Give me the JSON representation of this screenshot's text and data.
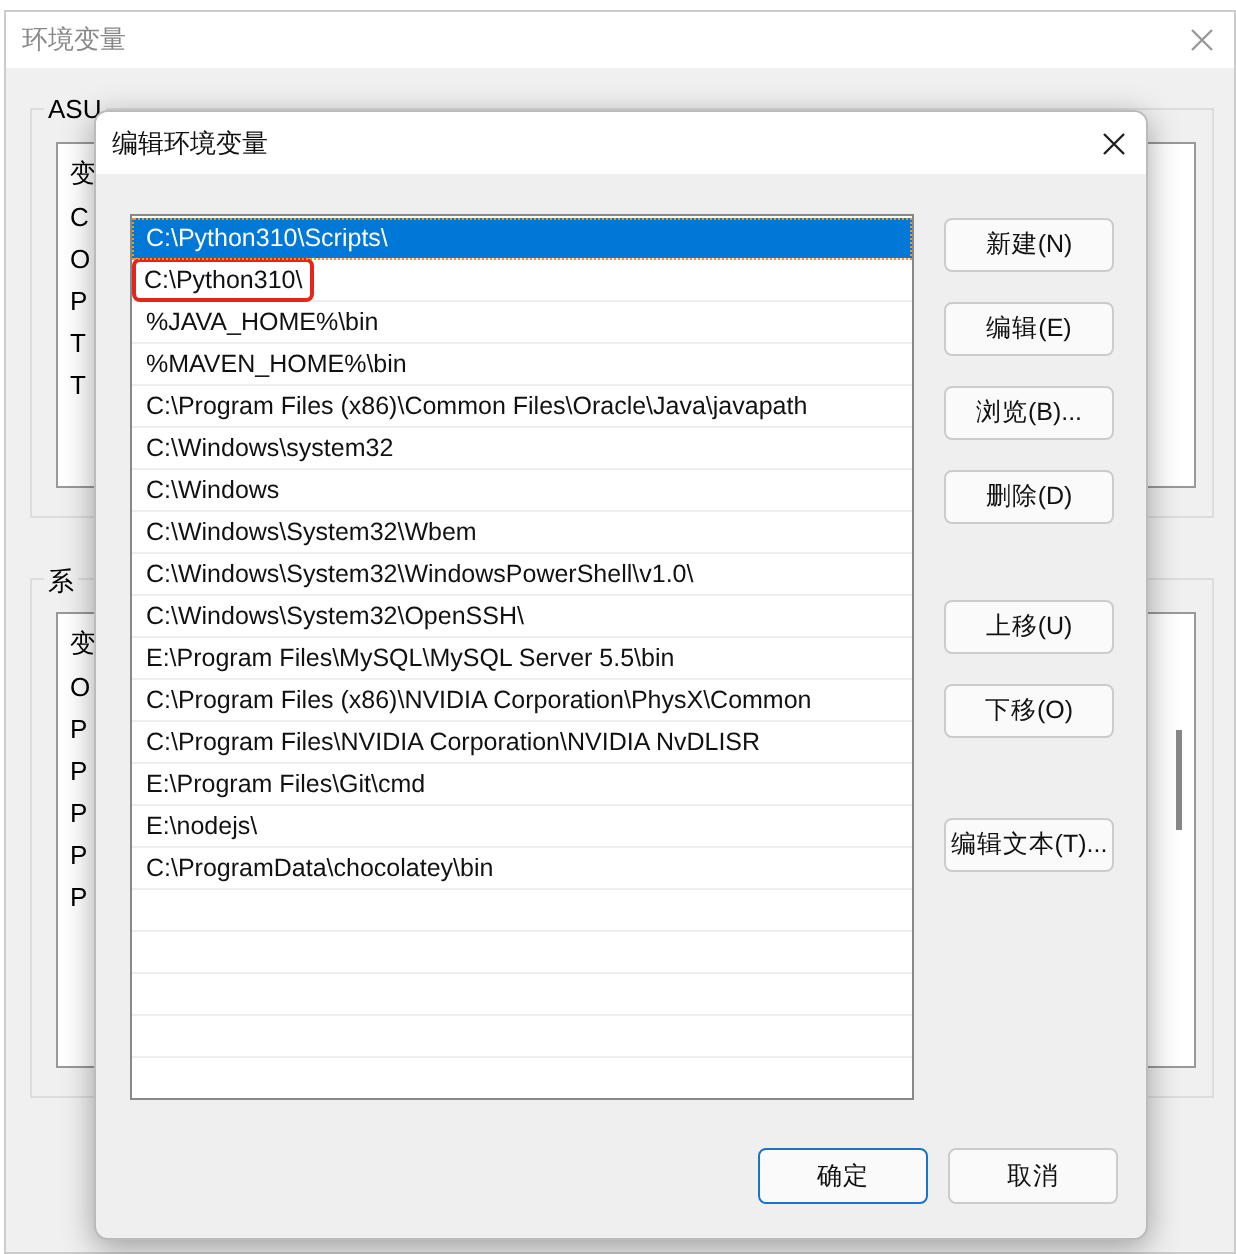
{
  "background_window": {
    "title": "环境变量",
    "user_group": {
      "label": "ASU",
      "header": "变",
      "items": [
        "C",
        "O",
        "P",
        "T",
        "T"
      ]
    },
    "system_group": {
      "label": "系",
      "header": "变",
      "items": [
        "O",
        "P",
        "P",
        "P",
        "P",
        "P"
      ]
    }
  },
  "dialog": {
    "title": "编辑环境变量",
    "paths": [
      {
        "text": "C:\\Python310\\Scripts\\",
        "selected": true,
        "annotated": false
      },
      {
        "text": "C:\\Python310\\",
        "selected": false,
        "annotated": true
      },
      {
        "text": "%JAVA_HOME%\\bin",
        "selected": false,
        "annotated": false
      },
      {
        "text": "%MAVEN_HOME%\\bin",
        "selected": false,
        "annotated": false
      },
      {
        "text": "C:\\Program Files (x86)\\Common Files\\Oracle\\Java\\javapath",
        "selected": false,
        "annotated": false
      },
      {
        "text": "C:\\Windows\\system32",
        "selected": false,
        "annotated": false
      },
      {
        "text": "C:\\Windows",
        "selected": false,
        "annotated": false
      },
      {
        "text": "C:\\Windows\\System32\\Wbem",
        "selected": false,
        "annotated": false
      },
      {
        "text": "C:\\Windows\\System32\\WindowsPowerShell\\v1.0\\",
        "selected": false,
        "annotated": false
      },
      {
        "text": "C:\\Windows\\System32\\OpenSSH\\",
        "selected": false,
        "annotated": false
      },
      {
        "text": "E:\\Program Files\\MySQL\\MySQL Server 5.5\\bin",
        "selected": false,
        "annotated": false
      },
      {
        "text": "C:\\Program Files (x86)\\NVIDIA Corporation\\PhysX\\Common",
        "selected": false,
        "annotated": false
      },
      {
        "text": "C:\\Program Files\\NVIDIA Corporation\\NVIDIA NvDLISR",
        "selected": false,
        "annotated": false
      },
      {
        "text": "E:\\Program Files\\Git\\cmd",
        "selected": false,
        "annotated": false
      },
      {
        "text": "E:\\nodejs\\",
        "selected": false,
        "annotated": false
      },
      {
        "text": "C:\\ProgramData\\chocolatey\\bin",
        "selected": false,
        "annotated": false
      }
    ],
    "button_groups": [
      [
        "新建(N)",
        "编辑(E)",
        "浏览(B)...",
        "删除(D)"
      ],
      [
        "上移(U)",
        "下移(O)"
      ],
      [
        "编辑文本(T)..."
      ]
    ],
    "footer_buttons": [
      {
        "label": "确定",
        "kind": "default"
      },
      {
        "label": "取消",
        "kind": "normal"
      }
    ]
  }
}
